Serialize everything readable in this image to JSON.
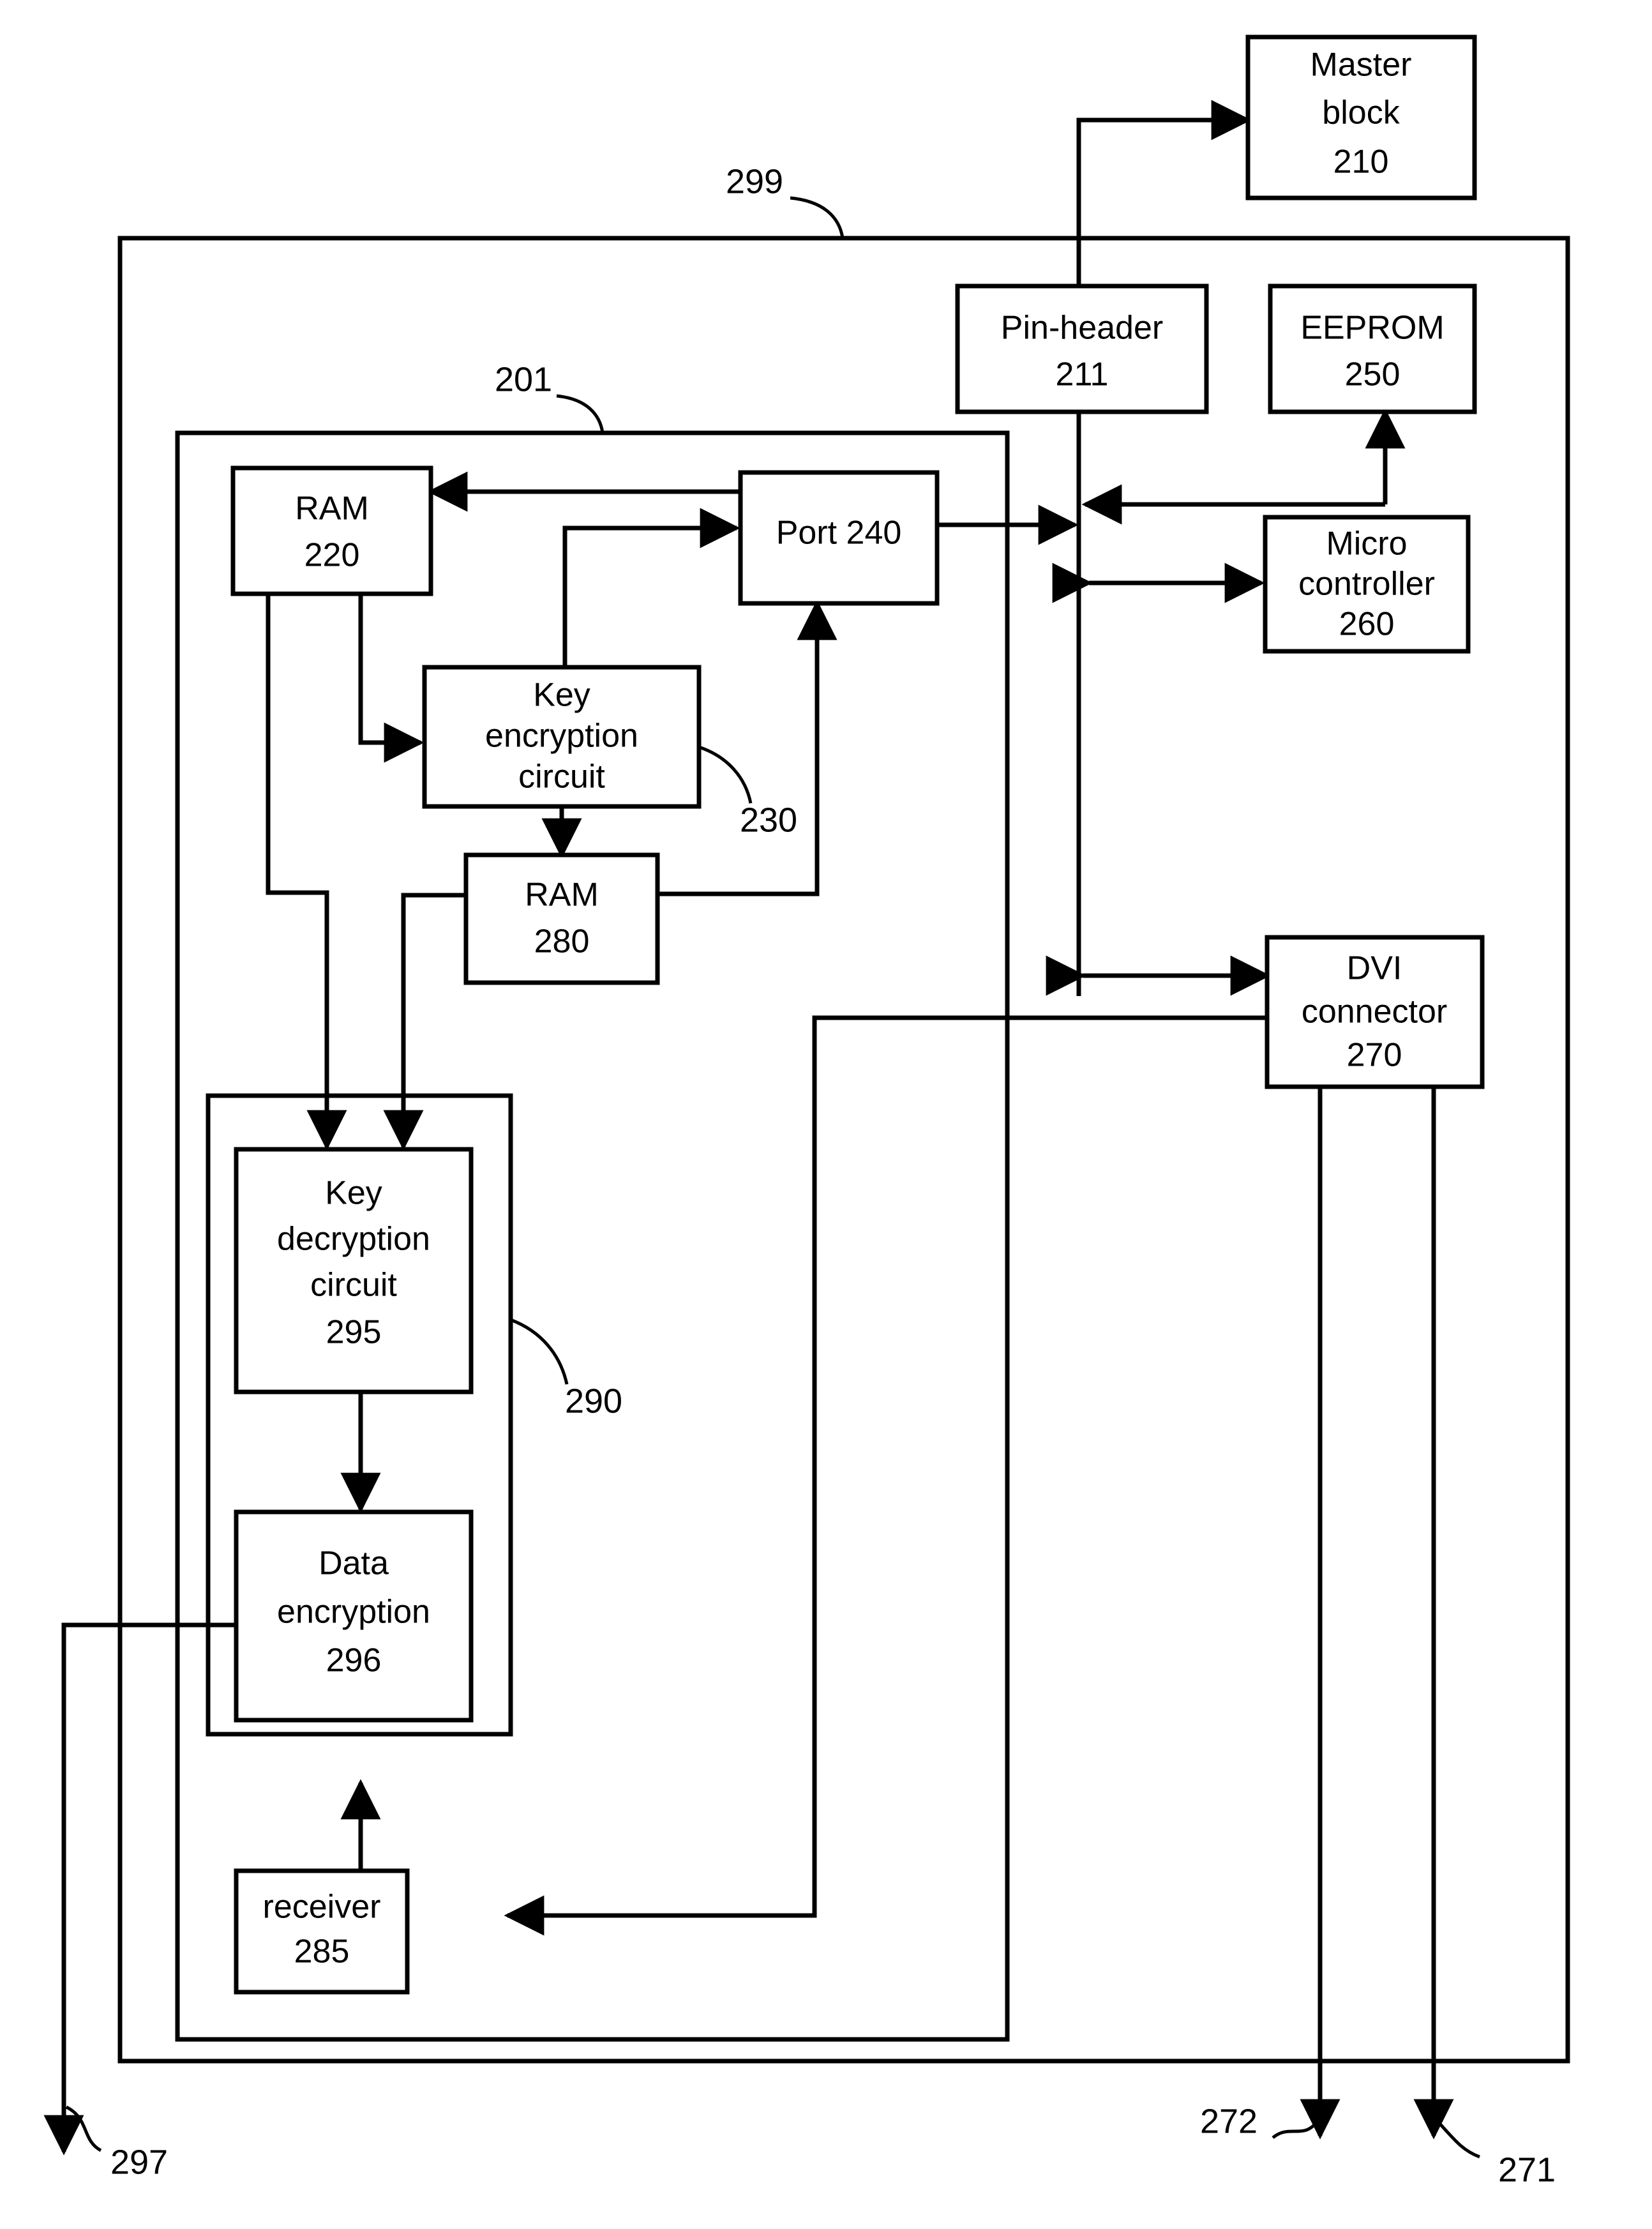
{
  "figure": {
    "kind": "patent-block-diagram",
    "background_color": "#ffffff",
    "line_color": "#000000"
  },
  "blocks": {
    "master_block": {
      "line1": "Master",
      "line2": "block",
      "ref": "210"
    },
    "pin_header": {
      "line1": "Pin-header",
      "ref": "211"
    },
    "eeprom": {
      "line1": "EEPROM",
      "ref": "250"
    },
    "micro": {
      "line1": "Micro",
      "line2": "controller",
      "ref": "260"
    },
    "dvi": {
      "line1": "DVI",
      "line2": "connector",
      "ref": "270"
    },
    "ram220": {
      "line1": "RAM",
      "ref": "220"
    },
    "port240": {
      "line1": "Port 240"
    },
    "key_enc": {
      "line1": "Key",
      "line2": "encryption",
      "line3": "circuit"
    },
    "ram280": {
      "line1": "RAM",
      "ref": "280"
    },
    "key_dec": {
      "line1": "Key",
      "line2": "decryption",
      "line3": "circuit",
      "ref": "295"
    },
    "data_enc": {
      "line1": "Data",
      "line2": "encryption",
      "ref": "296"
    },
    "receiver": {
      "line1": "receiver",
      "ref": "285"
    }
  },
  "reference_numerals": {
    "outer_enclosure": "299",
    "inner_enclosure": "201",
    "key_encryption_group": "230",
    "decryption_group": "290",
    "output_left": "297",
    "output_mid": "272",
    "output_right": "271"
  }
}
